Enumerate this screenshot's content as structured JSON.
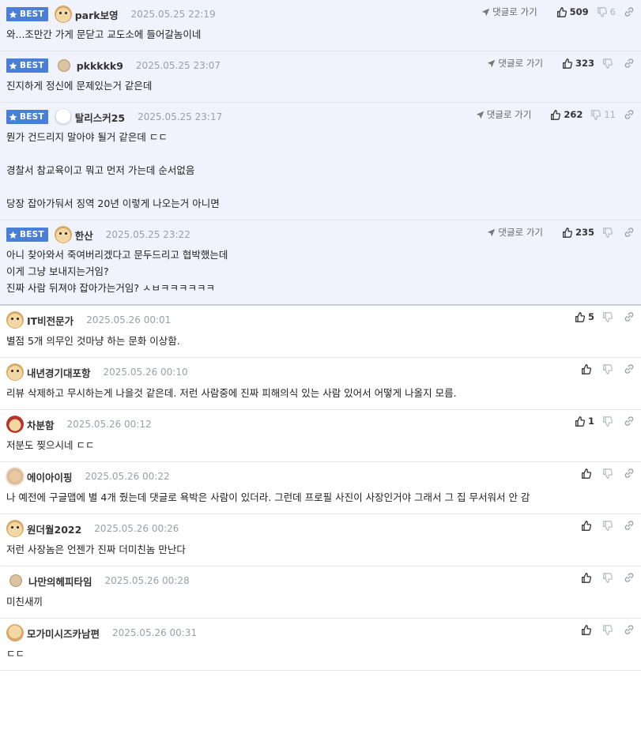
{
  "labels": {
    "best": "BEST",
    "goto_comment": "댓글로 가기"
  },
  "colors": {
    "best_badge": "#4a7fd8",
    "best_bg": "#f0f3fb",
    "divider": "#e3e6ea"
  },
  "comments": [
    {
      "best": true,
      "avatar": "puppy-avatar",
      "nick": "park보영",
      "date": "2025.05.25 22:19",
      "likes": "509",
      "dislikes": "6",
      "text": "와...조만간 가게 문닫고 교도소에 들어갈놈이네"
    },
    {
      "best": true,
      "avatar": "bear-avatar",
      "nick": "pkkkkk9",
      "date": "2025.05.25 23:07",
      "likes": "323",
      "dislikes": "",
      "text": "진지하게 정신에 문제있는거 같은데"
    },
    {
      "best": true,
      "avatar": "polar-bear-avatar",
      "nick": "탈리스커25",
      "date": "2025.05.25 23:17",
      "likes": "262",
      "dislikes": "11",
      "text": "뭔가 건드리지 말아야 될거 같은데 ㄷㄷ\n\n경찰서 참교육이고 뭐고 먼저 가는데 순서없음\n\n당장 잡아가둬서 징역 20년 이렇게 나오는거 아니면"
    },
    {
      "best": true,
      "avatar": "puppy-avatar",
      "nick": "한산",
      "date": "2025.05.25 23:22",
      "likes": "235",
      "dislikes": "",
      "text": "아니 찾아와서 죽여버리겠다고 문두드리고 협박했는데\n이게 그냥 보내지는거임?\n진짜 사람 뒤져야 잡아가는거임? ㅅㅂㅋㅋㅋㅋㅋㅋ"
    },
    {
      "best": false,
      "avatar": "puppy-avatar",
      "nick": "IT비전문가",
      "date": "2025.05.26 00:01",
      "likes": "5",
      "dislikes": "",
      "text": "별점 5개 의무인 것마냥 하는 문화 이상함."
    },
    {
      "best": false,
      "avatar": "puppy-avatar",
      "nick": "내년경기대포항",
      "date": "2025.05.26 00:10",
      "likes": "",
      "dislikes": "",
      "text": "리뷰 삭제하고 무시하는게 나을것 같은데. 저런 사람중에 진짜 피해의식 있는 사람 있어서 어떻게 나올지 모름."
    },
    {
      "best": false,
      "avatar": "red-hood-avatar",
      "nick": "차분함",
      "date": "2025.05.26 00:12",
      "likes": "1",
      "dislikes": "",
      "text": "저분도 찢으시네 ㄷㄷ"
    },
    {
      "best": false,
      "avatar": "blurred-avatar",
      "nick": "에이아이핑",
      "date": "2025.05.26 00:22",
      "likes": "",
      "dislikes": "",
      "text": "나 예전에 구글맵에 별 4개 줬는데 댓글로 욕박은 사람이 있더라. 그런데 프로필 사진이 사장인거야 그래서 그 집 무서워서 안 감"
    },
    {
      "best": false,
      "avatar": "puppy-avatar",
      "nick": "원더월2022",
      "date": "2025.05.26 00:26",
      "likes": "",
      "dislikes": "",
      "text": "저런 사장놈은 언젠가 진짜 더미친놈 만난다"
    },
    {
      "best": false,
      "avatar": "bear-avatar",
      "nick": "나만의헤피타임",
      "date": "2025.05.26 00:28",
      "likes": "",
      "dislikes": "",
      "text": "미친새끼"
    },
    {
      "best": false,
      "avatar": "puppy-tie-avatar",
      "nick": "모가미시즈카남편",
      "date": "2025.05.26 00:31",
      "likes": "",
      "dislikes": "",
      "text": "ㄷㄷ"
    }
  ]
}
